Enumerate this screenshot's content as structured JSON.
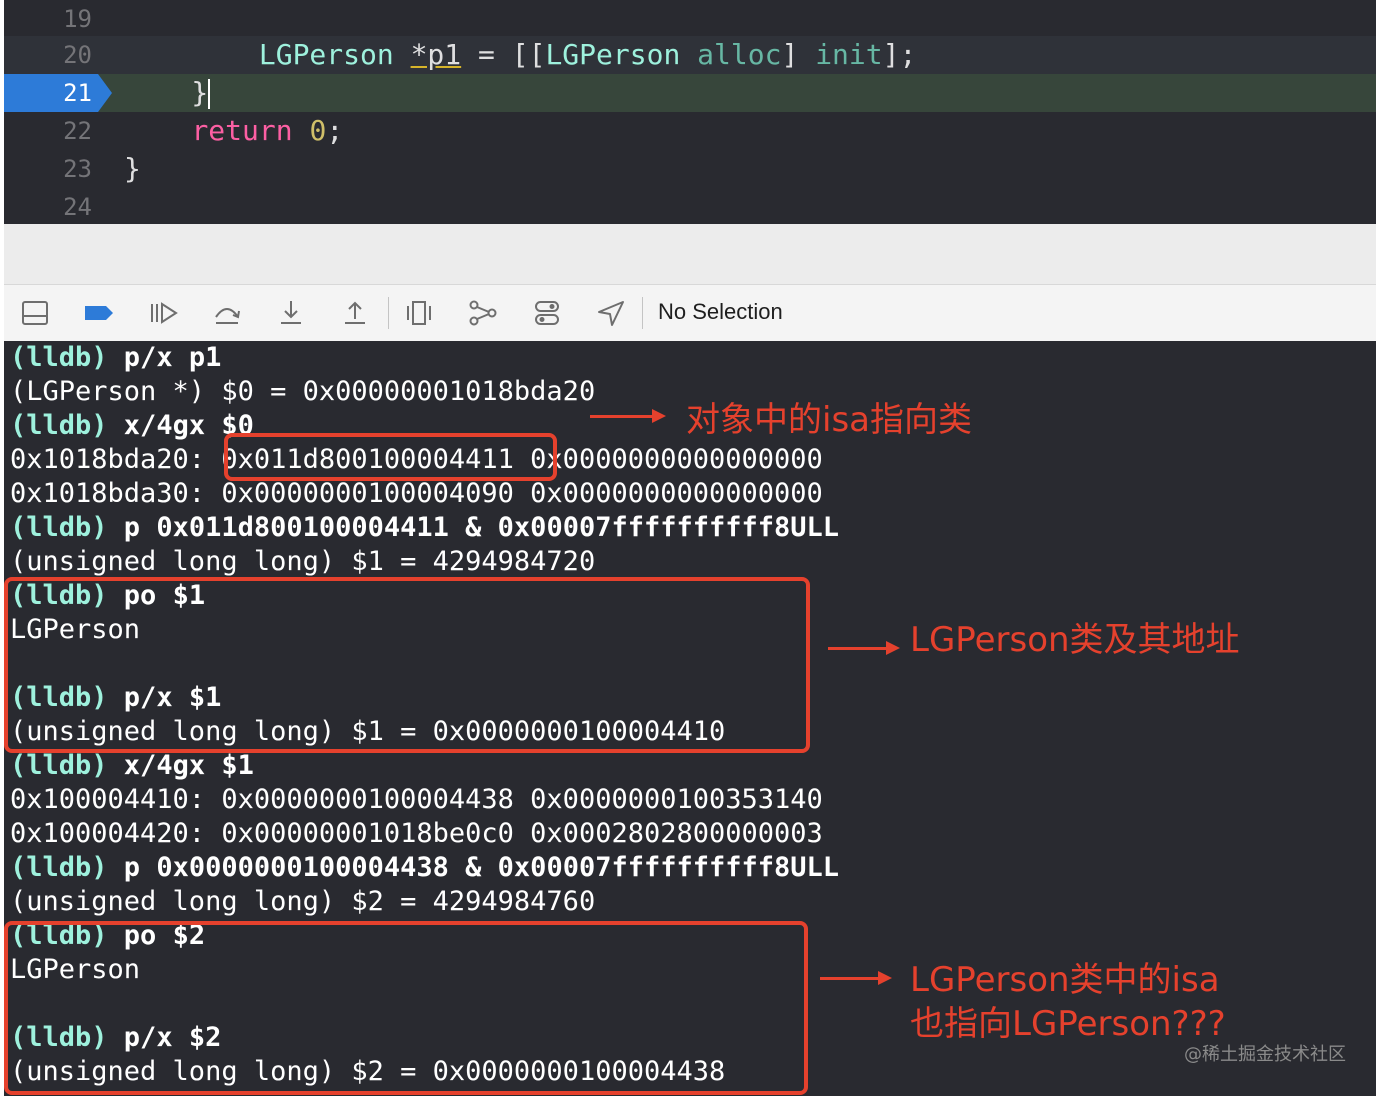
{
  "editor": {
    "lines": [
      {
        "num": "19",
        "code": ""
      },
      {
        "num": "20",
        "indent": "        ",
        "type1": "LGPerson",
        "var": "*p1",
        "eq": " = [[",
        "type2": "LGPerson",
        "sp": " ",
        "fn1": "alloc",
        "mid": "] ",
        "fn2": "init",
        "tail": "];"
      },
      {
        "num": "21",
        "code": "    }"
      },
      {
        "num": "22",
        "indent": "    ",
        "kw": "return",
        "sp": " ",
        "num_lit": "0",
        "tail": ";"
      },
      {
        "num": "23",
        "code": "}"
      },
      {
        "num": "24",
        "code": ""
      }
    ]
  },
  "toolbar": {
    "selection_label": "No Selection",
    "icons": [
      "hide-console-icon",
      "breakpoints-toggle-icon",
      "continue-icon",
      "step-over-icon",
      "step-into-icon",
      "step-out-icon",
      "debug-view-hierarchy-icon",
      "memory-graph-icon",
      "environment-overrides-icon",
      "simulate-location-icon"
    ]
  },
  "console": {
    "lines": [
      {
        "prompt": "(lldb)",
        "cmd": " p/x p1"
      },
      {
        "text": "(LGPerson *) $0 = 0x00000001018bda20"
      },
      {
        "prompt": "(lldb)",
        "cmd": " x/4gx $0"
      },
      {
        "text": "0x1018bda20: 0x011d800100004411 0x0000000000000000"
      },
      {
        "text": "0x1018bda30: 0x0000000100004090 0x0000000000000000"
      },
      {
        "prompt": "(lldb)",
        "cmd": " p 0x011d800100004411 & 0x00007ffffffffff8ULL"
      },
      {
        "text": "(unsigned long long) $1 = 4294984720"
      },
      {
        "prompt": "(lldb)",
        "cmd": " po $1"
      },
      {
        "text": "LGPerson"
      },
      {
        "text": ""
      },
      {
        "prompt": "(lldb)",
        "cmd": " p/x $1"
      },
      {
        "text": "(unsigned long long) $1 = 0x0000000100004410"
      },
      {
        "prompt": "(lldb)",
        "cmd": " x/4gx $1"
      },
      {
        "text": "0x100004410: 0x0000000100004438 0x0000000100353140"
      },
      {
        "text": "0x100004420: 0x00000001018be0c0 0x0002802800000003"
      },
      {
        "prompt": "(lldb)",
        "cmd": " p 0x0000000100004438 & 0x00007ffffffffff8ULL"
      },
      {
        "text": "(unsigned long long) $2 = 4294984760"
      },
      {
        "prompt": "(lldb)",
        "cmd": " po $2"
      },
      {
        "text": "LGPerson"
      },
      {
        "text": ""
      },
      {
        "prompt": "(lldb)",
        "cmd": " p/x $2"
      },
      {
        "text": "(unsigned long long) $2 = 0x0000000100004438"
      }
    ]
  },
  "annotations": {
    "note1": "对象中的isa指向类",
    "note2": "LGPerson类及其地址",
    "note3": "LGPerson类中的isa\n也指向LGPerson???",
    "color": "#e5412d"
  },
  "watermark": "@稀土掘金技术社区"
}
